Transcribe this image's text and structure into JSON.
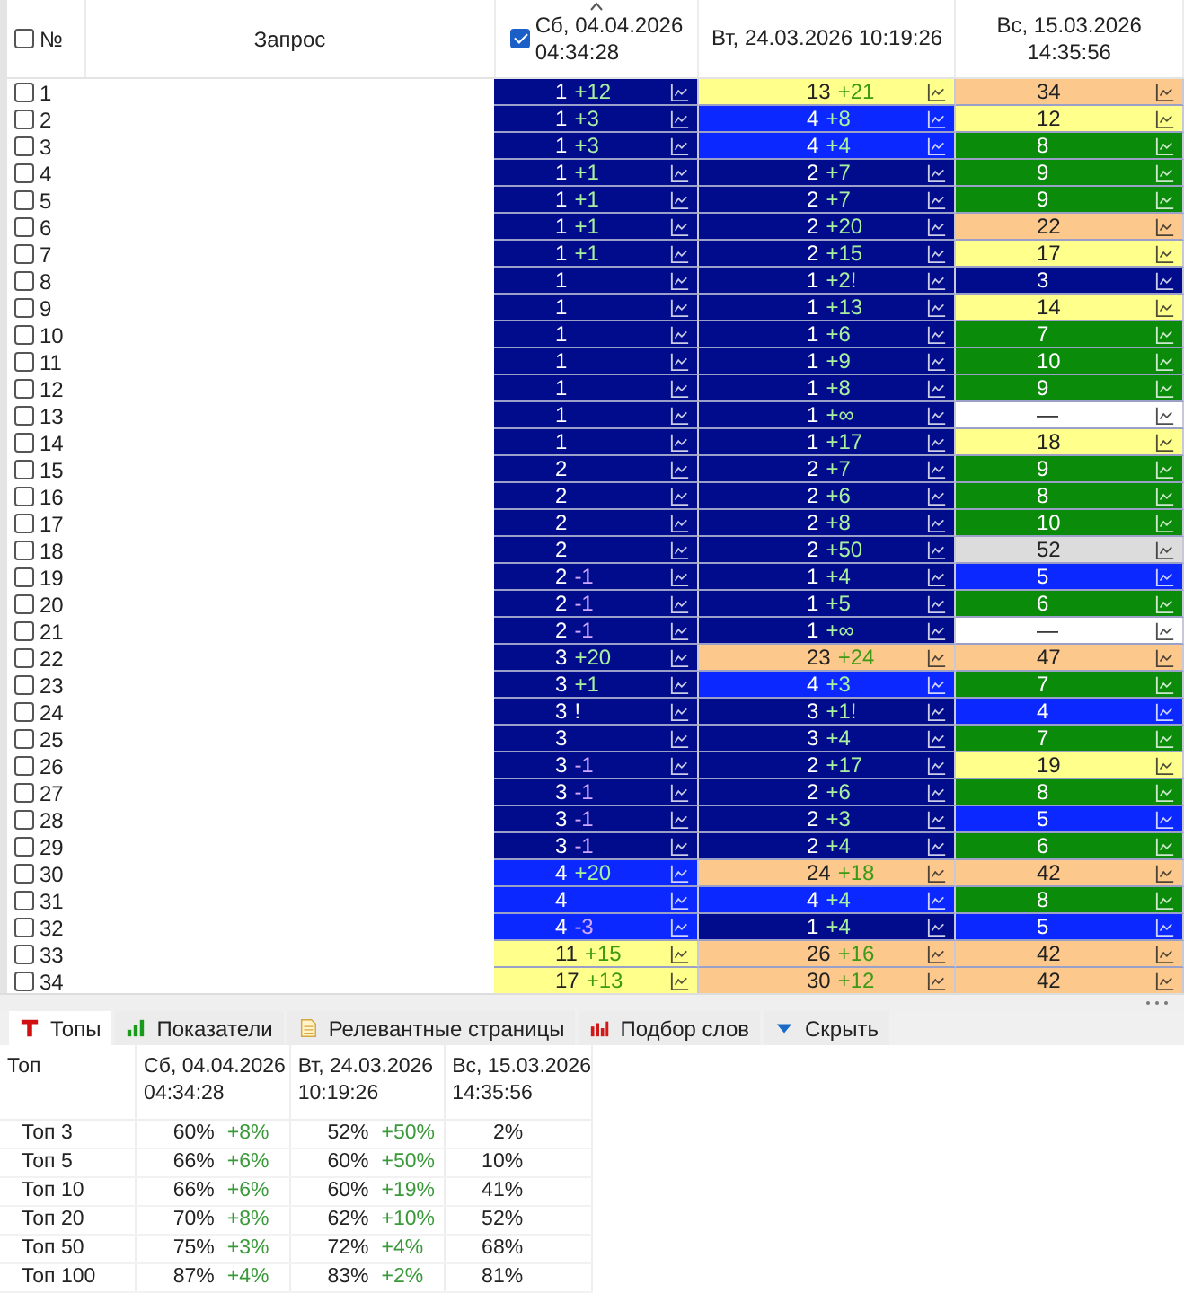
{
  "table": {
    "header": {
      "select_all": {
        "checked": false
      },
      "number": "№",
      "query": "Запрос",
      "dates": [
        {
          "label": "Сб, 04.04.2026\n04:34:28",
          "checked": true,
          "sorted": true
        },
        {
          "label": "Вт, 24.03.2026 10:19:26",
          "checked": false,
          "sorted": false
        },
        {
          "label": "Вс, 15.03.2026 14:35:56",
          "checked": false,
          "sorted": false
        }
      ]
    },
    "rows": [
      {
        "number": "1",
        "checked": false,
        "cells": [
          {
            "value": "1",
            "delta": "+12",
            "kind": "up",
            "color": "#000c8c"
          },
          {
            "value": "13",
            "delta": "+21",
            "kind": "up",
            "color": "#ffff8c"
          },
          {
            "value": "34",
            "color": "#fcc88c"
          }
        ]
      },
      {
        "number": "2",
        "checked": false,
        "cells": [
          {
            "value": "1",
            "delta": "+3",
            "kind": "up",
            "color": "#000c8c"
          },
          {
            "value": "4",
            "delta": "+8",
            "kind": "up",
            "color": "#0a28ff"
          },
          {
            "value": "12",
            "color": "#ffff8c"
          }
        ]
      },
      {
        "number": "3",
        "checked": false,
        "cells": [
          {
            "value": "1",
            "delta": "+3",
            "kind": "up",
            "color": "#000c8c"
          },
          {
            "value": "4",
            "delta": "+4",
            "kind": "up",
            "color": "#0a28ff"
          },
          {
            "value": "8",
            "color": "#0a8c0a"
          }
        ]
      },
      {
        "number": "4",
        "checked": false,
        "cells": [
          {
            "value": "1",
            "delta": "+1",
            "kind": "up",
            "color": "#000c8c"
          },
          {
            "value": "2",
            "delta": "+7",
            "kind": "up",
            "color": "#000c8c"
          },
          {
            "value": "9",
            "color": "#0a8c0a"
          }
        ]
      },
      {
        "number": "5",
        "checked": false,
        "cells": [
          {
            "value": "1",
            "delta": "+1",
            "kind": "up",
            "color": "#000c8c"
          },
          {
            "value": "2",
            "delta": "+7",
            "kind": "up",
            "color": "#000c8c"
          },
          {
            "value": "9",
            "color": "#0a8c0a"
          }
        ]
      },
      {
        "number": "6",
        "checked": false,
        "cells": [
          {
            "value": "1",
            "delta": "+1",
            "kind": "up",
            "color": "#000c8c"
          },
          {
            "value": "2",
            "delta": "+20",
            "kind": "up",
            "color": "#000c8c"
          },
          {
            "value": "22",
            "color": "#fcc88c"
          }
        ]
      },
      {
        "number": "7",
        "checked": false,
        "cells": [
          {
            "value": "1",
            "delta": "+1",
            "kind": "up",
            "color": "#000c8c"
          },
          {
            "value": "2",
            "delta": "+15",
            "kind": "up",
            "color": "#000c8c"
          },
          {
            "value": "17",
            "color": "#ffff8c"
          }
        ]
      },
      {
        "number": "8",
        "checked": false,
        "cells": [
          {
            "value": "1",
            "color": "#000c8c"
          },
          {
            "value": "1",
            "delta": "+2!",
            "kind": "up",
            "color": "#000c8c"
          },
          {
            "value": "3",
            "color": "#000c8c"
          }
        ]
      },
      {
        "number": "9",
        "checked": false,
        "cells": [
          {
            "value": "1",
            "color": "#000c8c"
          },
          {
            "value": "1",
            "delta": "+13",
            "kind": "up",
            "color": "#000c8c"
          },
          {
            "value": "14",
            "color": "#ffff8c"
          }
        ]
      },
      {
        "number": "10",
        "checked": false,
        "cells": [
          {
            "value": "1",
            "color": "#000c8c"
          },
          {
            "value": "1",
            "delta": "+6",
            "kind": "up",
            "color": "#000c8c"
          },
          {
            "value": "7",
            "color": "#0a8c0a"
          }
        ]
      },
      {
        "number": "11",
        "checked": false,
        "cells": [
          {
            "value": "1",
            "color": "#000c8c"
          },
          {
            "value": "1",
            "delta": "+9",
            "kind": "up",
            "color": "#000c8c"
          },
          {
            "value": "10",
            "color": "#0a8c0a"
          }
        ]
      },
      {
        "number": "12",
        "checked": false,
        "cells": [
          {
            "value": "1",
            "color": "#000c8c"
          },
          {
            "value": "1",
            "delta": "+8",
            "kind": "up",
            "color": "#000c8c"
          },
          {
            "value": "9",
            "color": "#0a8c0a"
          }
        ]
      },
      {
        "number": "13",
        "checked": false,
        "cells": [
          {
            "value": "1",
            "color": "#000c8c"
          },
          {
            "value": "1",
            "delta": "+∞",
            "kind": "up",
            "color": "#000c8c"
          },
          {
            "value": "—",
            "color": "#ffffff"
          }
        ]
      },
      {
        "number": "14",
        "checked": false,
        "cells": [
          {
            "value": "1",
            "color": "#000c8c"
          },
          {
            "value": "1",
            "delta": "+17",
            "kind": "up",
            "color": "#000c8c"
          },
          {
            "value": "18",
            "color": "#ffff8c"
          }
        ]
      },
      {
        "number": "15",
        "checked": false,
        "cells": [
          {
            "value": "2",
            "color": "#000c8c"
          },
          {
            "value": "2",
            "delta": "+7",
            "kind": "up",
            "color": "#000c8c"
          },
          {
            "value": "9",
            "color": "#0a8c0a"
          }
        ]
      },
      {
        "number": "16",
        "checked": false,
        "cells": [
          {
            "value": "2",
            "color": "#000c8c"
          },
          {
            "value": "2",
            "delta": "+6",
            "kind": "up",
            "color": "#000c8c"
          },
          {
            "value": "8",
            "color": "#0a8c0a"
          }
        ]
      },
      {
        "number": "17",
        "checked": false,
        "cells": [
          {
            "value": "2",
            "color": "#000c8c"
          },
          {
            "value": "2",
            "delta": "+8",
            "kind": "up",
            "color": "#000c8c"
          },
          {
            "value": "10",
            "color": "#0a8c0a"
          }
        ]
      },
      {
        "number": "18",
        "checked": false,
        "cells": [
          {
            "value": "2",
            "color": "#000c8c"
          },
          {
            "value": "2",
            "delta": "+50",
            "kind": "up",
            "color": "#000c8c"
          },
          {
            "value": "52",
            "color": "#dcdcdc"
          }
        ]
      },
      {
        "number": "19",
        "checked": false,
        "cells": [
          {
            "value": "2",
            "delta": "-1",
            "kind": "down",
            "color": "#000c8c"
          },
          {
            "value": "1",
            "delta": "+4",
            "kind": "up",
            "color": "#000c8c"
          },
          {
            "value": "5",
            "color": "#0a28ff"
          }
        ]
      },
      {
        "number": "20",
        "checked": false,
        "cells": [
          {
            "value": "2",
            "delta": "-1",
            "kind": "down",
            "color": "#000c8c"
          },
          {
            "value": "1",
            "delta": "+5",
            "kind": "up",
            "color": "#000c8c"
          },
          {
            "value": "6",
            "color": "#0a8c0a"
          }
        ]
      },
      {
        "number": "21",
        "checked": false,
        "cells": [
          {
            "value": "2",
            "delta": "-1",
            "kind": "down",
            "color": "#000c8c"
          },
          {
            "value": "1",
            "delta": "+∞",
            "kind": "up",
            "color": "#000c8c"
          },
          {
            "value": "—",
            "color": "#ffffff"
          }
        ]
      },
      {
        "number": "22",
        "checked": false,
        "cells": [
          {
            "value": "3",
            "delta": "+20",
            "kind": "up",
            "color": "#000c8c"
          },
          {
            "value": "23",
            "delta": "+24",
            "kind": "up",
            "color": "#fcc88c"
          },
          {
            "value": "47",
            "color": "#fcc88c"
          }
        ]
      },
      {
        "number": "23",
        "checked": false,
        "cells": [
          {
            "value": "3",
            "delta": "+1",
            "kind": "up",
            "color": "#000c8c"
          },
          {
            "value": "4",
            "delta": "+3",
            "kind": "up",
            "color": "#0a28ff"
          },
          {
            "value": "7",
            "color": "#0a8c0a"
          }
        ]
      },
      {
        "number": "24",
        "checked": false,
        "cells": [
          {
            "value": "3",
            "delta": "!",
            "kind": "flag",
            "color": "#000c8c"
          },
          {
            "value": "3",
            "delta": "+1!",
            "kind": "up",
            "color": "#000c8c"
          },
          {
            "value": "4",
            "color": "#0a28ff"
          }
        ]
      },
      {
        "number": "25",
        "checked": false,
        "cells": [
          {
            "value": "3",
            "color": "#000c8c"
          },
          {
            "value": "3",
            "delta": "+4",
            "kind": "up",
            "color": "#000c8c"
          },
          {
            "value": "7",
            "color": "#0a8c0a"
          }
        ]
      },
      {
        "number": "26",
        "checked": false,
        "cells": [
          {
            "value": "3",
            "delta": "-1",
            "kind": "down",
            "color": "#000c8c"
          },
          {
            "value": "2",
            "delta": "+17",
            "kind": "up",
            "color": "#000c8c"
          },
          {
            "value": "19",
            "color": "#ffff8c"
          }
        ]
      },
      {
        "number": "27",
        "checked": false,
        "cells": [
          {
            "value": "3",
            "delta": "-1",
            "kind": "down",
            "color": "#000c8c"
          },
          {
            "value": "2",
            "delta": "+6",
            "kind": "up",
            "color": "#000c8c"
          },
          {
            "value": "8",
            "color": "#0a8c0a"
          }
        ]
      },
      {
        "number": "28",
        "checked": false,
        "cells": [
          {
            "value": "3",
            "delta": "-1",
            "kind": "down",
            "color": "#000c8c"
          },
          {
            "value": "2",
            "delta": "+3",
            "kind": "up",
            "color": "#000c8c"
          },
          {
            "value": "5",
            "color": "#0a28ff"
          }
        ]
      },
      {
        "number": "29",
        "checked": false,
        "cells": [
          {
            "value": "3",
            "delta": "-1",
            "kind": "down",
            "color": "#000c8c"
          },
          {
            "value": "2",
            "delta": "+4",
            "kind": "up",
            "color": "#000c8c"
          },
          {
            "value": "6",
            "color": "#0a8c0a"
          }
        ]
      },
      {
        "number": "30",
        "checked": false,
        "cells": [
          {
            "value": "4",
            "delta": "+20",
            "kind": "up",
            "color": "#0a28ff"
          },
          {
            "value": "24",
            "delta": "+18",
            "kind": "up",
            "color": "#fcc88c"
          },
          {
            "value": "42",
            "color": "#fcc88c"
          }
        ]
      },
      {
        "number": "31",
        "checked": false,
        "cells": [
          {
            "value": "4",
            "color": "#0a28ff"
          },
          {
            "value": "4",
            "delta": "+4",
            "kind": "up",
            "color": "#0a28ff"
          },
          {
            "value": "8",
            "color": "#0a8c0a"
          }
        ]
      },
      {
        "number": "32",
        "checked": false,
        "cells": [
          {
            "value": "4",
            "delta": "-3",
            "kind": "down",
            "color": "#0a28ff"
          },
          {
            "value": "1",
            "delta": "+4",
            "kind": "up",
            "color": "#000c8c"
          },
          {
            "value": "5",
            "color": "#0a28ff"
          }
        ]
      },
      {
        "number": "33",
        "checked": false,
        "cells": [
          {
            "value": "11",
            "delta": "+15",
            "kind": "up",
            "color": "#ffff8c"
          },
          {
            "value": "26",
            "delta": "+16",
            "kind": "up",
            "color": "#fcc88c"
          },
          {
            "value": "42",
            "color": "#fcc88c"
          }
        ]
      },
      {
        "number": "34",
        "checked": false,
        "cells": [
          {
            "value": "17",
            "delta": "+13",
            "kind": "up",
            "color": "#ffff8c"
          },
          {
            "value": "30",
            "delta": "+12",
            "kind": "up",
            "color": "#fcc88c"
          },
          {
            "value": "42",
            "color": "#fcc88c"
          }
        ]
      }
    ]
  },
  "bottom_panel": {
    "tabs": [
      {
        "label": "Топы",
        "kind": "tops",
        "selected": true
      },
      {
        "label": "Показатели",
        "kind": "metrics",
        "selected": false
      },
      {
        "label": "Релевантные страницы",
        "kind": "pages",
        "selected": false
      },
      {
        "label": "Подбор слов",
        "kind": "words",
        "selected": false
      },
      {
        "label": "Скрыть",
        "kind": "hide",
        "selected": false
      }
    ],
    "table": {
      "columns": [
        "Топ",
        "Сб, 04.04.2026\n04:34:28",
        "Вт, 24.03.2026\n10:19:26",
        "Вс, 15.03.2026\n14:35:56"
      ],
      "rows": [
        {
          "cells": [
            {
              "value": "Топ 3"
            },
            {
              "value": "60%",
              "delta": "+8%"
            },
            {
              "value": "52%",
              "delta": "+50%"
            },
            {
              "value": "2%"
            }
          ]
        },
        {
          "cells": [
            {
              "value": "Топ 5"
            },
            {
              "value": "66%",
              "delta": "+6%"
            },
            {
              "value": "60%",
              "delta": "+50%"
            },
            {
              "value": "10%"
            }
          ]
        },
        {
          "cells": [
            {
              "value": "Топ 10"
            },
            {
              "value": "66%",
              "delta": "+6%"
            },
            {
              "value": "60%",
              "delta": "+19%"
            },
            {
              "value": "41%"
            }
          ]
        },
        {
          "cells": [
            {
              "value": "Топ 20"
            },
            {
              "value": "70%",
              "delta": "+8%"
            },
            {
              "value": "62%",
              "delta": "+10%"
            },
            {
              "value": "52%"
            }
          ]
        },
        {
          "cells": [
            {
              "value": "Топ 50"
            },
            {
              "value": "75%",
              "delta": "+3%"
            },
            {
              "value": "72%",
              "delta": "+4%"
            },
            {
              "value": "68%"
            }
          ]
        },
        {
          "cells": [
            {
              "value": "Топ 100"
            },
            {
              "value": "87%",
              "delta": "+4%"
            },
            {
              "value": "83%",
              "delta": "+2%"
            },
            {
              "value": "81%"
            }
          ]
        }
      ]
    }
  }
}
